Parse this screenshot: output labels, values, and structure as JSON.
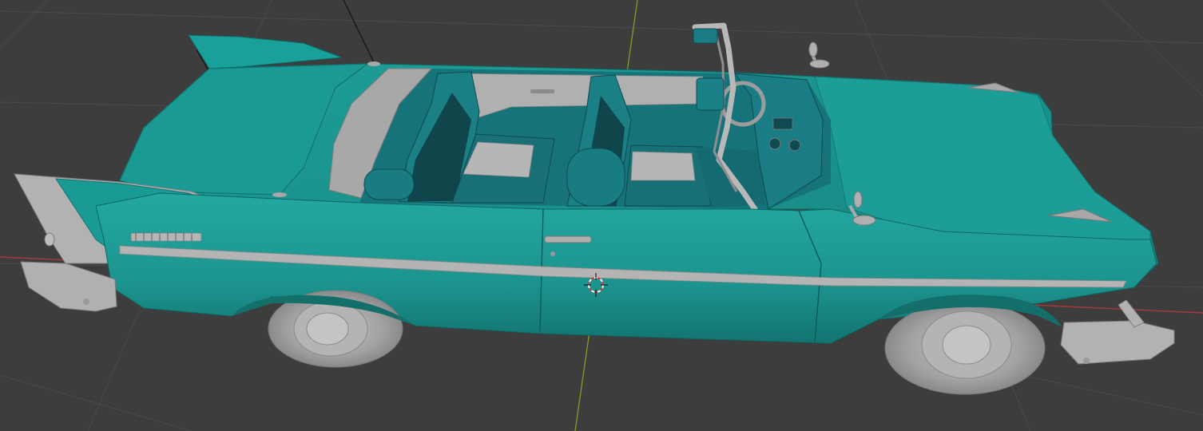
{
  "viewport": {
    "background_color": "#3d3d3d",
    "grid_color": "#474747",
    "x_axis_color": "#a83a3f",
    "y_axis_color": "#7c9a2a"
  },
  "model": {
    "body_color": "#1f9a94",
    "body_shadow_color": "#157a76",
    "body_dark_color": "#0f5d5a",
    "chrome_color": "#a8a8a8",
    "chrome_light_color": "#c8c8c8",
    "interior_color": "#17737a",
    "interior_dark_color": "#0e4a50"
  },
  "cursor": {
    "icon": "3d-cursor-icon",
    "primary_color": "#ffffff",
    "secondary_color": "#d23b3b"
  }
}
